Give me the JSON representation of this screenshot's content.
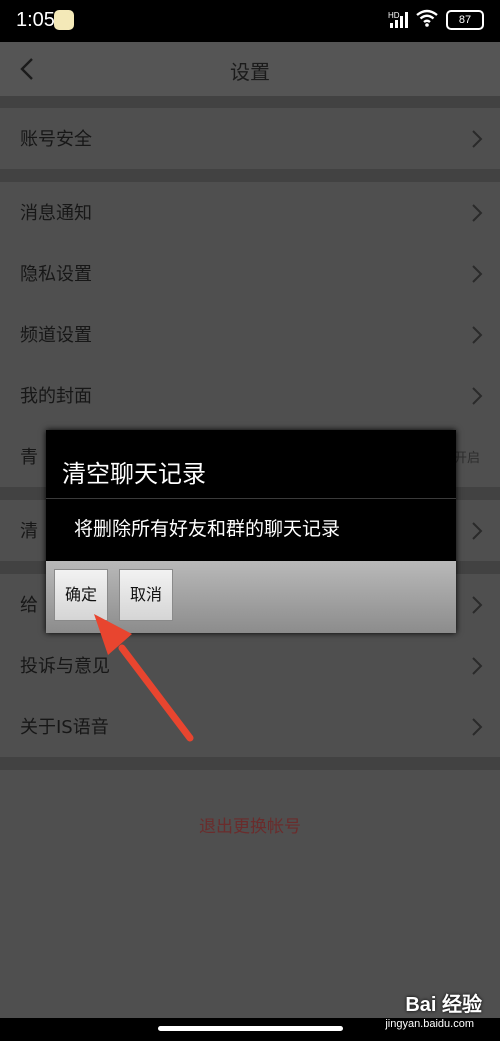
{
  "status_bar": {
    "time": "1:05",
    "network": "HD",
    "battery": "87"
  },
  "nav": {
    "title": "设置"
  },
  "settings": [
    {
      "label": "账号安全"
    },
    {
      "label": "消息通知"
    },
    {
      "label": "隐私设置"
    },
    {
      "label": "频道设置"
    },
    {
      "label": "我的封面"
    },
    {
      "label": "青",
      "value": "开启"
    },
    {
      "label": "清"
    },
    {
      "label": "给"
    },
    {
      "label": "投诉与意见"
    },
    {
      "label": "关于IS语音"
    }
  ],
  "logout_label": "退出更换帐号",
  "dialog": {
    "title": "清空聊天记录",
    "message": "将删除所有好友和群的聊天记录",
    "confirm": "确定",
    "cancel": "取消"
  },
  "watermark": {
    "brand": "Bai 经验",
    "url": "jingyan.baidu.com"
  },
  "colors": {
    "annotation_arrow": "#e8452f",
    "logout_text": "#6a2c2c"
  }
}
